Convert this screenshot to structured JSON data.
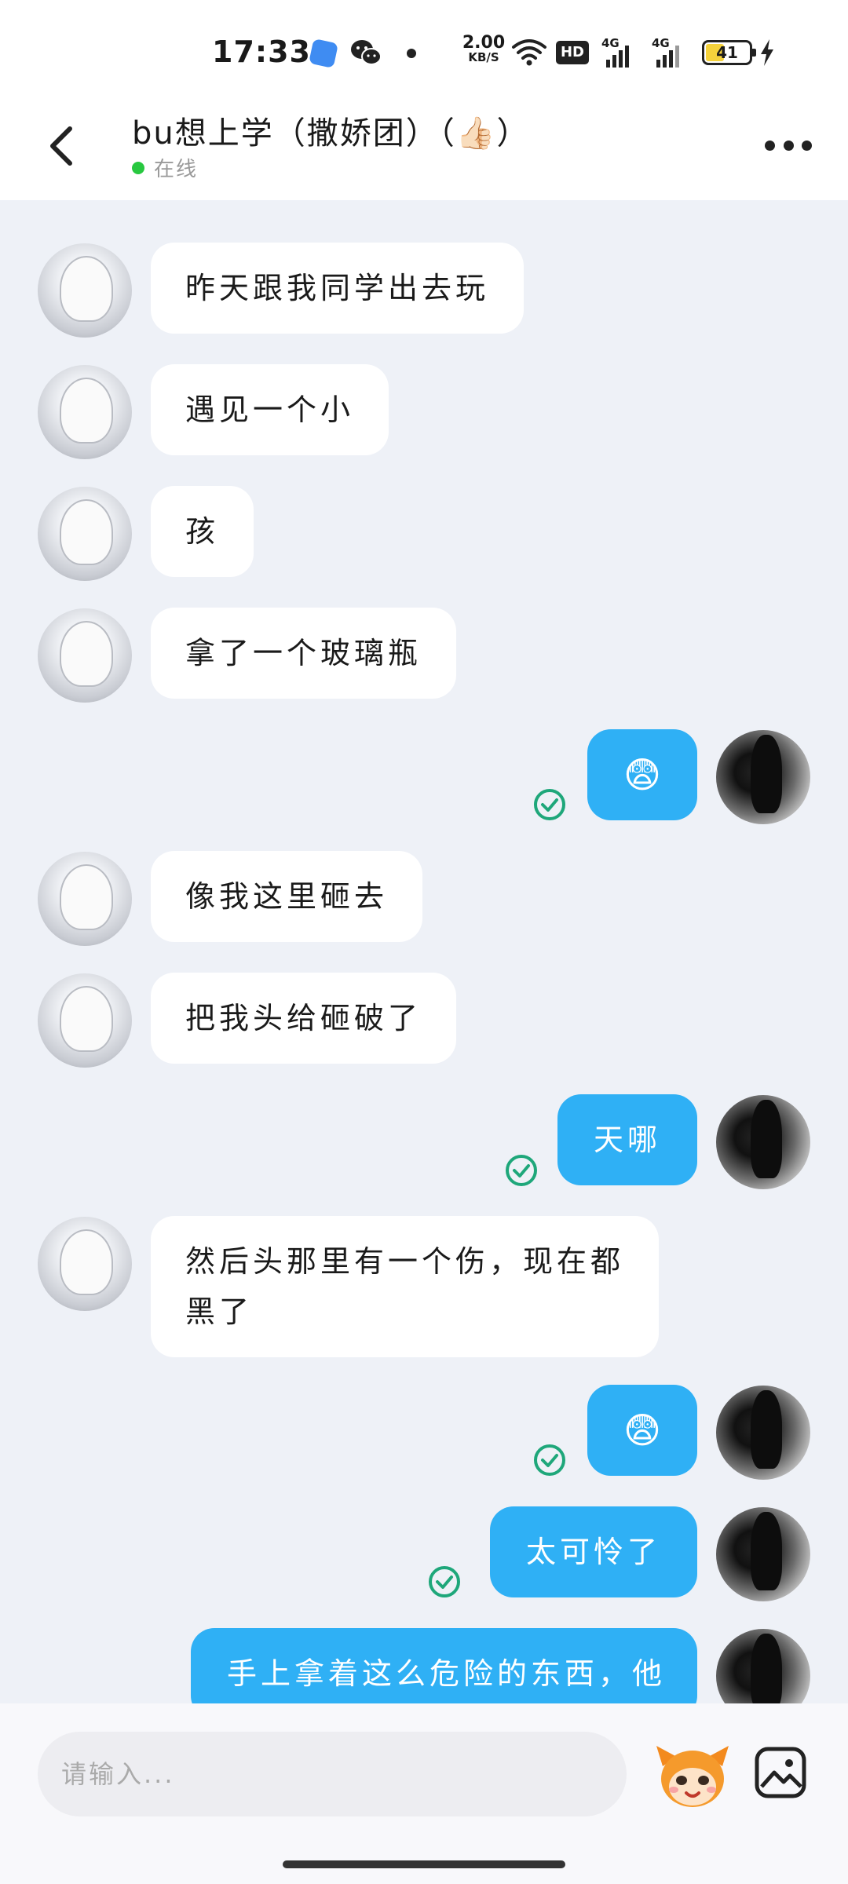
{
  "status_bar": {
    "time": "17:33",
    "net_speed_value": "2.00",
    "net_speed_unit": "KB/S",
    "hd_badge": "HD",
    "signal1_label": "4G",
    "signal2_label": "4G",
    "battery_level": "41"
  },
  "header": {
    "title": "bu想上学（撒娇团）（👍🏻）",
    "online_status": "在线"
  },
  "messages": [
    {
      "side": "in",
      "text": "昨天跟我同学出去玩"
    },
    {
      "side": "in",
      "text": "遇见一个小"
    },
    {
      "side": "in",
      "text": "孩"
    },
    {
      "side": "in",
      "text": "拿了一个玻璃瓶"
    },
    {
      "side": "out",
      "text": "😨",
      "read": true
    },
    {
      "side": "in",
      "text": "像我这里砸去"
    },
    {
      "side": "in",
      "text": "把我头给砸破了"
    },
    {
      "side": "out",
      "text": "天哪",
      "read": true
    },
    {
      "side": "in",
      "text": "然后头那里有一个伤，现在都",
      "text_line2": "黑了"
    },
    {
      "side": "out",
      "text": "😨",
      "read": true
    },
    {
      "side": "out",
      "text": "太可怜了",
      "read": true
    },
    {
      "side": "out",
      "text": "手上拿着这么危险的东西，他"
    }
  ],
  "composer": {
    "placeholder": "请输入..."
  },
  "colors": {
    "outgoing_bubble": "#2fb0f5",
    "incoming_bubble": "#ffffff",
    "background": "#eef1f7",
    "online_dot": "#28c840",
    "read_check": "#1ea77a"
  },
  "icons": [
    "back-arrow-icon",
    "more-icon",
    "read-check-icon",
    "sticker-icon",
    "gallery-icon",
    "wifi-icon",
    "battery-icon",
    "wechat-icon"
  ]
}
